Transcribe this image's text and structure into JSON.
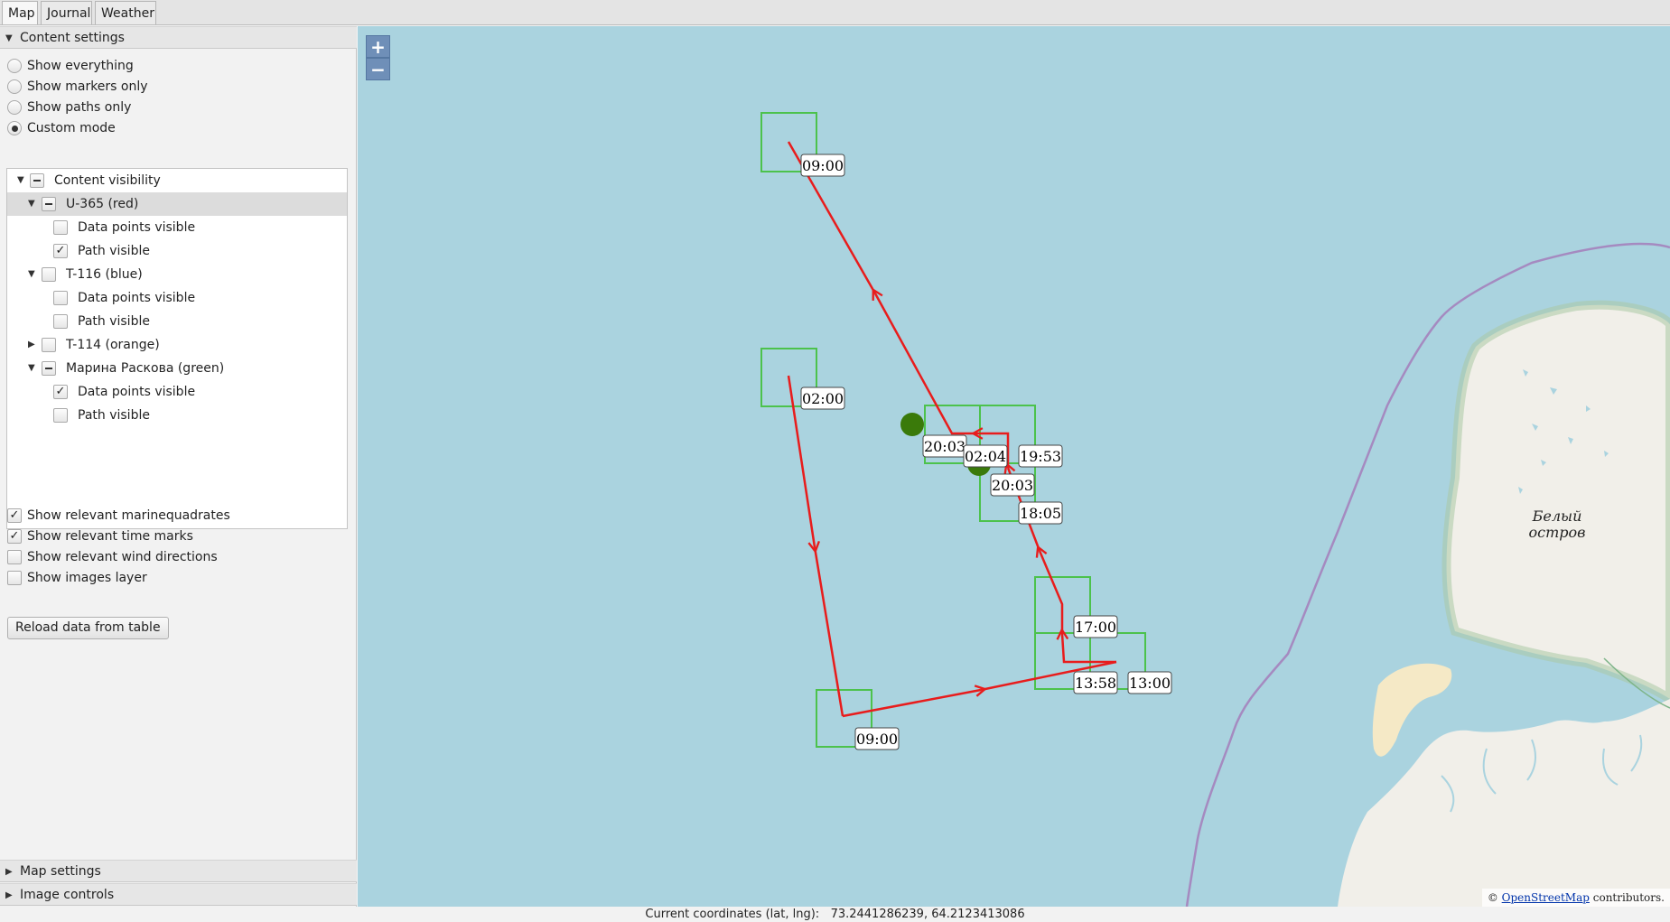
{
  "tabs": [
    {
      "label": "Map",
      "active": true
    },
    {
      "label": "Journal",
      "active": false
    },
    {
      "label": "Weather",
      "active": false
    }
  ],
  "sidebar": {
    "content_settings_title": "Content settings",
    "modes": [
      {
        "label": "Show everything",
        "selected": false
      },
      {
        "label": "Show markers only",
        "selected": false
      },
      {
        "label": "Show paths only",
        "selected": false
      },
      {
        "label": "Custom mode",
        "selected": true
      }
    ],
    "tree": [
      {
        "label": "Content visibility",
        "state": "indeterminate"
      },
      {
        "label": "U-365 (red)",
        "state": "indeterminate"
      },
      {
        "label": "Data points visible",
        "state": "unchecked"
      },
      {
        "label": "Path visible",
        "state": "checked"
      },
      {
        "label": "T-116 (blue)",
        "state": "unchecked"
      },
      {
        "label": "Data points visible",
        "state": "unchecked"
      },
      {
        "label": "Path visible",
        "state": "unchecked"
      },
      {
        "label": "T-114 (orange)",
        "state": "unchecked"
      },
      {
        "label": "Марина Раскова (green)",
        "state": "indeterminate"
      },
      {
        "label": "Data points visible",
        "state": "checked"
      },
      {
        "label": "Path visible",
        "state": "unchecked"
      }
    ],
    "options": [
      {
        "label": "Show relevant marinequadrates",
        "checked": true
      },
      {
        "label": "Show relevant time marks",
        "checked": true
      },
      {
        "label": "Show relevant wind directions",
        "checked": false
      },
      {
        "label": "Show images layer",
        "checked": false
      }
    ],
    "reload_button": "Reload data from table",
    "map_settings_title": "Map settings",
    "image_controls_title": "Image controls"
  },
  "map": {
    "zoom_in": "+",
    "zoom_out": "−",
    "island_label_1": "Белый",
    "island_label_2": "остров",
    "attribution_prefix": "© ",
    "attribution_link": "OpenStreetMap",
    "attribution_suffix": " contributors.",
    "path_color": "#e81c1c",
    "quadrate_color": "#4cc24c",
    "marker_color": "#3a7a0a",
    "time_labels": [
      "09:00",
      "02:00",
      "20:03",
      "02:04",
      "19:53",
      "20:03",
      "18:05",
      "17:00",
      "13:58",
      "13:00",
      "09:00"
    ]
  },
  "status": {
    "label": "Current coordinates (lat, lng):",
    "value": "73.2441286239, 64.2123413086"
  }
}
